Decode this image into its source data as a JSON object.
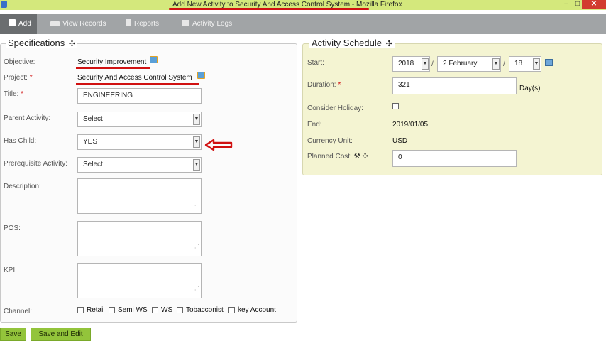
{
  "window": {
    "title": "Add New Activity to Security And Access Control System",
    "app_suffix": " - Mozilla Firefox",
    "min_label": "–",
    "max_label": "□",
    "close_label": "✕"
  },
  "toolbar": {
    "items": [
      {
        "label": "Add",
        "icon": "add-document-icon",
        "active": true
      },
      {
        "label": "View Records",
        "icon": "list-icon",
        "active": false
      },
      {
        "label": "Reports",
        "icon": "chart-icon",
        "active": false
      },
      {
        "label": "Activity Logs",
        "icon": "log-icon",
        "active": false
      }
    ]
  },
  "specifications": {
    "legend": "Specifications",
    "move_icon": "✣",
    "objective": {
      "label": "Objective:",
      "value": "Security Improvement"
    },
    "project": {
      "label": "Project:",
      "required": "*",
      "value": "Security And Access Control System"
    },
    "title": {
      "label": "Title:",
      "required": "*",
      "value": "ENGINEERING"
    },
    "parent_activity": {
      "label": "Parent Activity:",
      "value": "Select"
    },
    "has_child": {
      "label": "Has Child:",
      "value": "YES"
    },
    "prerequisite_activity": {
      "label": "Prerequisite Activity:",
      "value": "Select"
    },
    "description": {
      "label": "Description:",
      "value": ""
    },
    "pos": {
      "label": "POS:",
      "value": ""
    },
    "kpi": {
      "label": "KPI:",
      "value": ""
    },
    "channel": {
      "label": "Channel:",
      "options": [
        {
          "label": "Retail",
          "checked": false
        },
        {
          "label": "Semi WS",
          "checked": false
        },
        {
          "label": "WS",
          "checked": false
        },
        {
          "label": "Tobacconist",
          "checked": false
        },
        {
          "label": "key Account",
          "checked": false
        }
      ]
    }
  },
  "schedule": {
    "legend": "Activity Schedule",
    "move_icon": "✣",
    "start": {
      "label": "Start:",
      "year": "2018",
      "month": "2 February",
      "day": "18",
      "separator": "/"
    },
    "duration": {
      "label": "Duration:",
      "required": "*",
      "value": "321",
      "unit": "Day(s)"
    },
    "consider_holiday": {
      "label": "Consider Holiday:",
      "checked": false
    },
    "end": {
      "label": "End:",
      "value": "2019/01/05"
    },
    "currency_unit": {
      "label": "Currency Unit:",
      "value": "USD"
    },
    "planned_cost": {
      "label": "Planned Cost:",
      "value": "0",
      "wrench_icon": "🔧",
      "move_icon": "✣"
    }
  },
  "actions": {
    "save_label": "Save",
    "save_edit_label": "Save and Edit"
  },
  "colors": {
    "accent_green": "#93c43b",
    "annotation_red": "#d01010",
    "titlebar": "#d4e87c",
    "toolbar": "#a1a4a6",
    "schedule_bg": "#f4f4d2"
  }
}
